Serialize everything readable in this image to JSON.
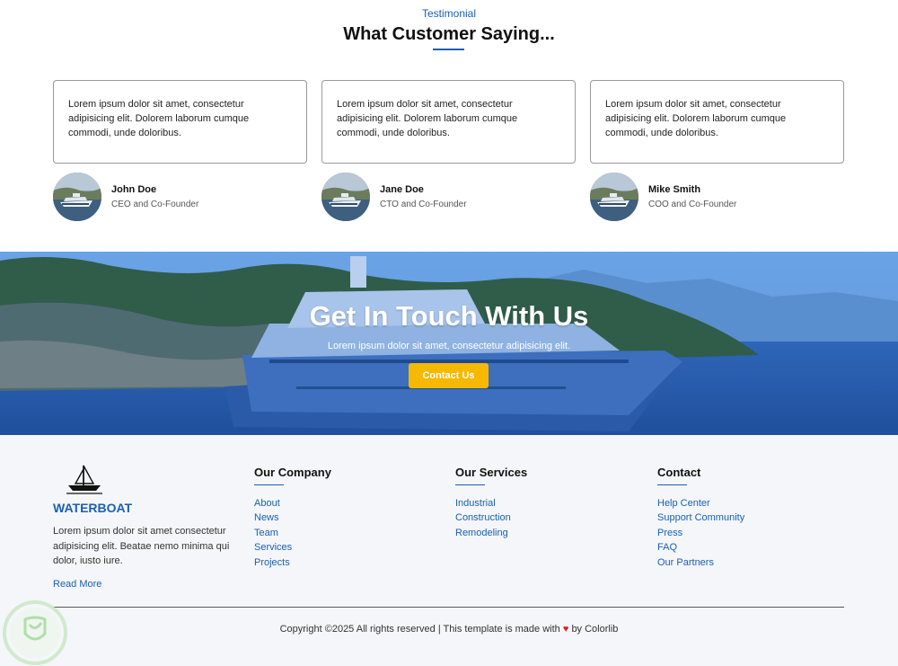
{
  "testimonial": {
    "subtitle": "Testimonial",
    "title": "What Customer Saying...",
    "items": [
      {
        "text": "Lorem ipsum dolor sit amet, consectetur adipisicing elit. Dolorem laborum cumque commodi, unde doloribus.",
        "name": "John Doe",
        "role": "CEO and Co-Founder"
      },
      {
        "text": "Lorem ipsum dolor sit amet, consectetur adipisicing elit. Dolorem laborum cumque commodi, unde doloribus.",
        "name": "Jane Doe",
        "role": "CTO and Co-Founder"
      },
      {
        "text": "Lorem ipsum dolor sit amet, consectetur adipisicing elit. Dolorem laborum cumque commodi, unde doloribus.",
        "name": "Mike Smith",
        "role": "COO and Co-Founder"
      }
    ]
  },
  "banner": {
    "title": "Get In Touch With Us",
    "subtitle": "Lorem ipsum dolor sit amet, consectetur adipisicing elit.",
    "button_label": "Contact Us"
  },
  "footer": {
    "brand": "WATERBOAT",
    "description": "Lorem ipsum dolor sit amet consectetur adipisicing elit. Beatae nemo minima qui dolor, iusto iure.",
    "read_more": "Read More",
    "columns": [
      {
        "heading": "Our Company",
        "links": [
          "About",
          "News",
          "Team",
          "Services",
          "Projects"
        ]
      },
      {
        "heading": "Our Services",
        "links": [
          "Industrial",
          "Construction",
          "Remodeling"
        ]
      },
      {
        "heading": "Contact",
        "links": [
          "Help Center",
          "Support Community",
          "Press",
          "FAQ",
          "Our Partners"
        ]
      }
    ],
    "copyright_prefix": "Copyright ©2025 All rights reserved | This template is made with",
    "heart_icon": "heart-icon",
    "copyright_suffix": "by Colorlib"
  },
  "colors": {
    "accent": "#1a5fb4",
    "button": "#f6b800",
    "heart": "#d4222a"
  }
}
